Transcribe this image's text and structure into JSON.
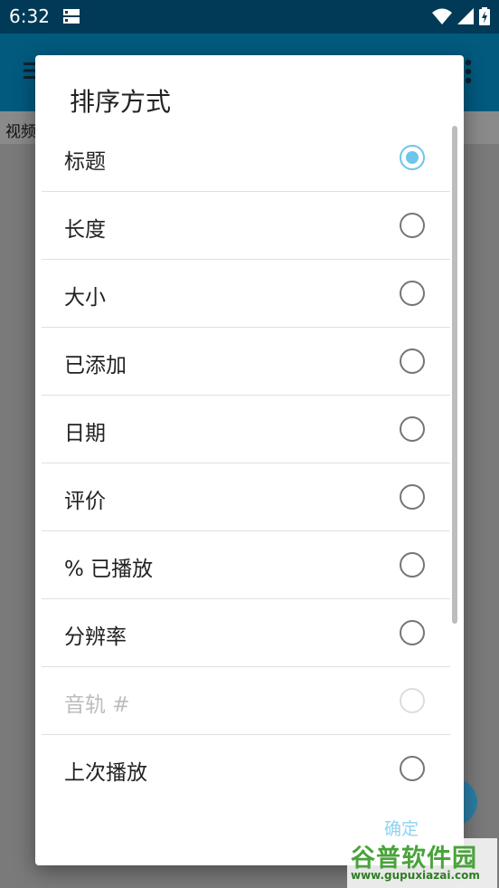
{
  "status_bar": {
    "time": "6:32",
    "icons": [
      "storage-icon",
      "wifi-icon",
      "signal-icon",
      "battery-charging-icon"
    ]
  },
  "app_bar": {
    "sub_label": "视频"
  },
  "dialog": {
    "title": "排序方式",
    "options": [
      {
        "label": "标题",
        "checked": true,
        "enabled": true
      },
      {
        "label": "长度",
        "checked": false,
        "enabled": true
      },
      {
        "label": "大小",
        "checked": false,
        "enabled": true
      },
      {
        "label": "已添加",
        "checked": false,
        "enabled": true
      },
      {
        "label": "日期",
        "checked": false,
        "enabled": true
      },
      {
        "label": "评价",
        "checked": false,
        "enabled": true
      },
      {
        "label": "% 已播放",
        "checked": false,
        "enabled": true
      },
      {
        "label": "分辨率",
        "checked": false,
        "enabled": true
      },
      {
        "label": "音轨 #",
        "checked": false,
        "enabled": false
      },
      {
        "label": "上次播放",
        "checked": false,
        "enabled": true
      }
    ],
    "ok_label": "确定"
  },
  "watermark": {
    "main": "谷普软件园",
    "url": "www.gupuxiazai.com"
  },
  "colors": {
    "accent": "#6cc6ec",
    "status_bar": "#003a57",
    "app_bar": "#025a7f"
  }
}
